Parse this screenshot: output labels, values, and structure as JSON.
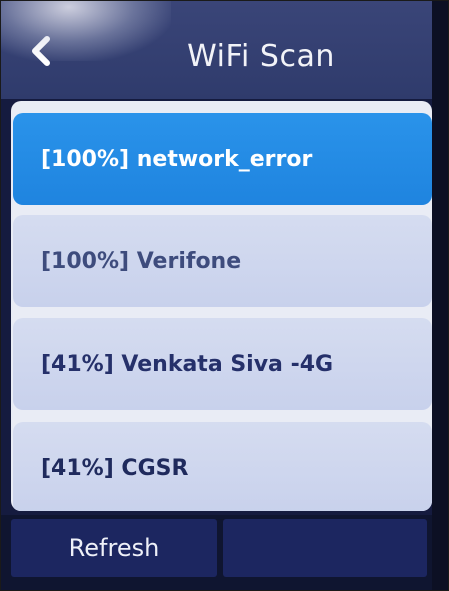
{
  "header": {
    "title": "WiFi Scan",
    "back_icon": "chevron-left-icon"
  },
  "networks": [
    {
      "label": "[100%] network_error",
      "selected": true
    },
    {
      "label": "[100%] Verifone",
      "selected": false
    },
    {
      "label": "[41%] Venkata Siva -4G",
      "selected": false
    },
    {
      "label": "[41%] CGSR",
      "selected": false
    }
  ],
  "footer": {
    "refresh_label": "Refresh",
    "secondary_label": ""
  },
  "colors": {
    "header": "#2f3b6c",
    "selected_item": "#1f84df",
    "item": "#c8d1ec",
    "footer_button": "#1c2660"
  }
}
